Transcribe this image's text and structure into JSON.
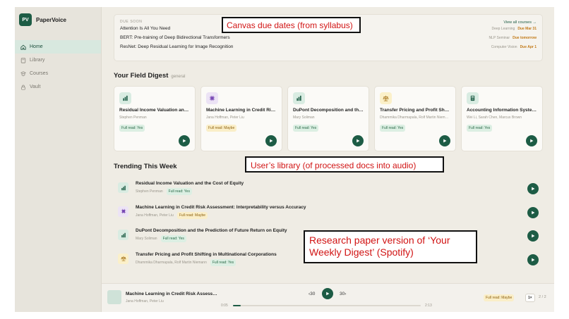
{
  "app": {
    "logo_initials": "PV",
    "name": "PaperVoice"
  },
  "sidebar": {
    "items": [
      {
        "label": "Home",
        "icon": "home-icon",
        "active": true
      },
      {
        "label": "Library",
        "icon": "library-icon",
        "active": false
      },
      {
        "label": "Courses",
        "icon": "courses-icon",
        "active": false
      },
      {
        "label": "Vault",
        "icon": "lock-icon",
        "active": false
      }
    ]
  },
  "due_soon": {
    "heading": "DUE SOON",
    "view_all": "View all courses →",
    "items": [
      {
        "title": "Attention Is All You Need",
        "course": "Deep Learning",
        "due": "Due Mar 31"
      },
      {
        "title": "BERT: Pre-training of Deep Bidirectional Transformers",
        "course": "NLP Seminar",
        "due": "Due tomorrow"
      },
      {
        "title": "ResNet: Deep Residual Learning for Image Recognition",
        "course": "Computer Vision",
        "due": "Due Apr 1"
      }
    ]
  },
  "digest": {
    "title": "Your Field Digest",
    "subtitle": "general",
    "cards": [
      {
        "title": "Residual Income Valuation and the Cost of Equity",
        "authors": "Stephen Penman",
        "badge": "Full read: Yes",
        "badge_type": "yes",
        "icon": "bar-chart-icon",
        "icon_bg": "#d9ece2",
        "icon_color": "#1d5c45"
      },
      {
        "title": "Machine Learning in Credit Risk Assessment",
        "authors": "Jana Hoffman, Peter Liu",
        "badge": "Full read: Maybe",
        "badge_type": "maybe",
        "icon": "chip-icon",
        "icon_bg": "#ece3f5",
        "icon_color": "#7a4bb5"
      },
      {
        "title": "DuPont Decomposition and the Prediction of Future Return",
        "authors": "Mary Soliman",
        "badge": "Full read: Yes",
        "badge_type": "yes",
        "icon": "bar-chart-icon",
        "icon_bg": "#d9ece2",
        "icon_color": "#1d5c45"
      },
      {
        "title": "Transfer Pricing and Profit Shifting",
        "authors": "Dhammika Dharmapala, Rolf Martin Niemann",
        "badge": "Full read: Yes",
        "badge_type": "yes",
        "icon": "scale-icon",
        "icon_bg": "#fbf0c9",
        "icon_color": "#a06a0c"
      },
      {
        "title": "Accounting Information Systems",
        "authors": "Wei Li, Sarah Chen, Marcus Brown",
        "badge": "Full read: Yes",
        "badge_type": "yes",
        "icon": "calculator-icon",
        "icon_bg": "#d9ece2",
        "icon_color": "#1d5c45"
      }
    ]
  },
  "trending": {
    "title": "Trending This Week",
    "items": [
      {
        "title": "Residual Income Valuation and the Cost of Equity",
        "authors": "Stephen Penman",
        "badge": "Full read: Yes",
        "badge_type": "yes",
        "icon": "bar-chart-icon",
        "icon_bg": "#d9ece2",
        "icon_color": "#1d5c45"
      },
      {
        "title": "Machine Learning in Credit Risk Assessment: Interpretability versus Accuracy",
        "authors": "Jana Hoffman, Peter Liu",
        "badge": "Full read: Maybe",
        "badge_type": "maybe",
        "icon": "chip-icon",
        "icon_bg": "#ece3f5",
        "icon_color": "#7a4bb5"
      },
      {
        "title": "DuPont Decomposition and the Prediction of Future Return on Equity",
        "authors": "Mary Soliman",
        "badge": "Full read: Yes",
        "badge_type": "yes",
        "icon": "bar-chart-icon",
        "icon_bg": "#d9ece2",
        "icon_color": "#1d5c45"
      },
      {
        "title": "Transfer Pricing and Profit Shifting in Multinational Corporations",
        "authors": "Dhammika Dharmapala, Rolf Martin Niemann",
        "badge": "Full read: Yes",
        "badge_type": "yes",
        "icon": "scale-icon",
        "icon_bg": "#fbf0c9",
        "icon_color": "#a06a0c"
      }
    ]
  },
  "player": {
    "title": "Machine Learning in Credit Risk Assessment",
    "authors": "Jana Hoffman, Peter Liu",
    "back_label": "‹30",
    "forward_label": "30›",
    "current_time": "0:05",
    "duration": "2:13",
    "progress": 0.04,
    "badge": "Full read: Maybe",
    "speed": "1×",
    "page": "2 / 2"
  },
  "annotations": {
    "canvas": "Canvas due dates (from syllabus)",
    "library": "User’s library (of processed docs into audio)",
    "digest": "Research paper version of ‘Your Weekly Digest’ (Spotify)"
  },
  "colors": {
    "brand_green": "#1d5c45",
    "due_orange": "#c27a18",
    "annotation_red": "#d11414"
  }
}
